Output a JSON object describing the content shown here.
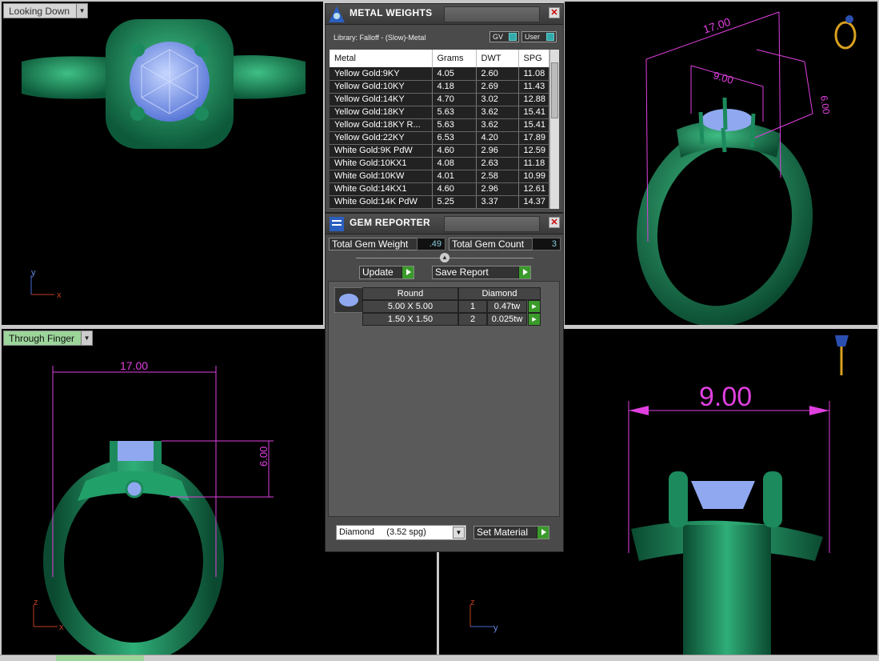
{
  "viewports": {
    "top_left_label": "Looking Down",
    "bottom_left_label": "Through Finger",
    "dims": {
      "tl_left_x": "x",
      "tl_left_y": "y",
      "bl_width": "17.00",
      "bl_height": "6.00",
      "bl_axis_z": "z",
      "bl_axis_x": "x",
      "tr_width": "17.00",
      "tr_inner": "9.00",
      "tr_height": "6.00",
      "br_width": "9.00",
      "br_axis_z": "z",
      "br_axis_y": "y"
    }
  },
  "metal_weights": {
    "title": "METAL WEIGHTS",
    "library": "Library: Falloff - (Slow)-Metal",
    "toggle_gv": "GV",
    "toggle_user": "User",
    "columns": [
      "Metal",
      "Grams",
      "DWT",
      "SPG"
    ],
    "rows": [
      [
        "Yellow Gold:9KY",
        "4.05",
        "2.60",
        "11.08"
      ],
      [
        "Yellow Gold:10KY",
        "4.18",
        "2.69",
        "11.43"
      ],
      [
        "Yellow Gold:14KY",
        "4.70",
        "3.02",
        "12.88"
      ],
      [
        "Yellow Gold:18KY",
        "5.63",
        "3.62",
        "15.41"
      ],
      [
        "Yellow Gold:18KY R...",
        "5.63",
        "3.62",
        "15.41"
      ],
      [
        "Yellow Gold:22KY",
        "6.53",
        "4.20",
        "17.89"
      ],
      [
        "White Gold:9K PdW",
        "4.60",
        "2.96",
        "12.59"
      ],
      [
        "White Gold:10KX1",
        "4.08",
        "2.63",
        "11.18"
      ],
      [
        "White Gold:10KW",
        "4.01",
        "2.58",
        "10.99"
      ],
      [
        "White Gold:14KX1",
        "4.60",
        "2.96",
        "12.61"
      ],
      [
        "White Gold:14K PdW",
        "5.25",
        "3.37",
        "14.37"
      ]
    ]
  },
  "gem_reporter": {
    "title": "GEM REPORTER",
    "total_weight_label": "Total Gem Weight",
    "total_weight_value": ".49",
    "total_count_label": "Total Gem Count",
    "total_count_value": "3",
    "update_label": "Update",
    "save_label": "Save Report",
    "gem_shape": "Round",
    "gem_type": "Diamond",
    "gems": [
      {
        "size": "5.00 X 5.00",
        "count": "1",
        "weight": "0.47tw"
      },
      {
        "size": "1.50 X 1.50",
        "count": "2",
        "weight": "0.025tw"
      }
    ],
    "material_select": "Diamond     (3.52 spg)",
    "set_material_label": "Set Material"
  },
  "colors": {
    "dimension": "#e040e0",
    "metal": "#1e8a5a",
    "gem": "#8fa8f0"
  }
}
